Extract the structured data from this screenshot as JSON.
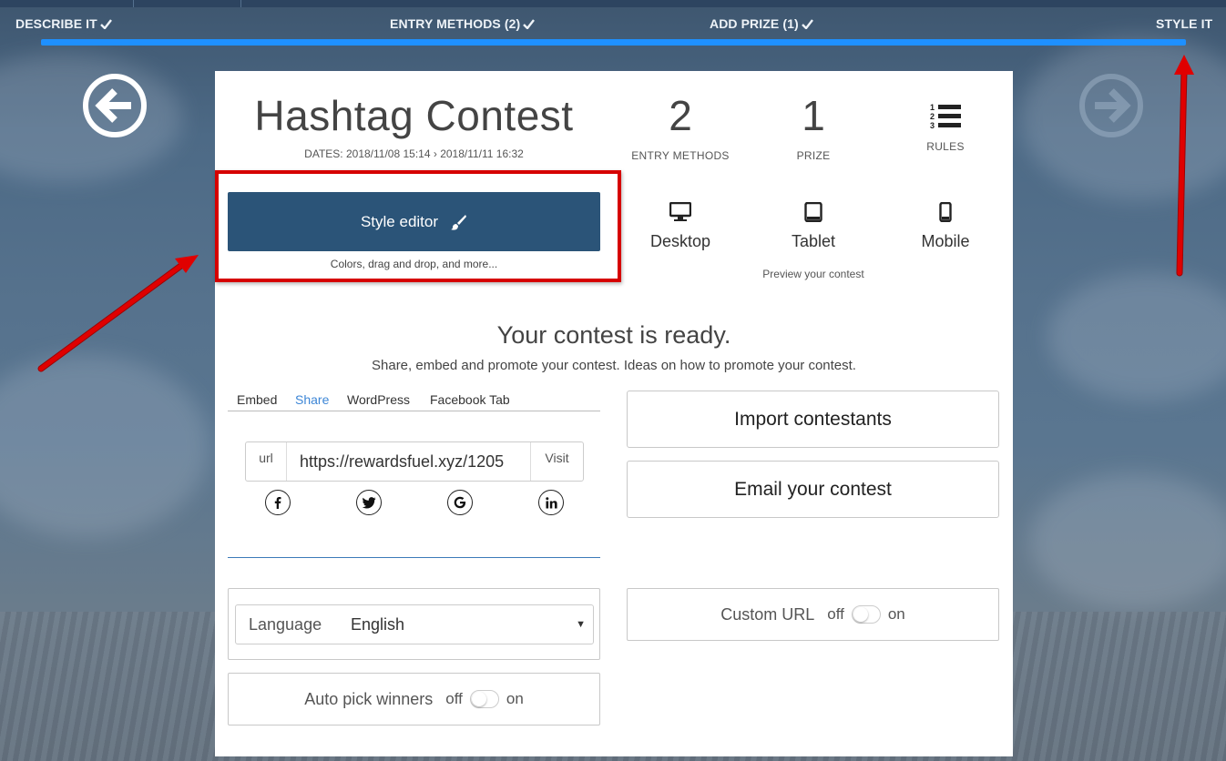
{
  "steps": [
    {
      "label": "DESCRIBE IT",
      "done": true
    },
    {
      "label": "ENTRY METHODS (2)",
      "done": true
    },
    {
      "label": "ADD PRIZE (1)",
      "done": true
    },
    {
      "label": "STYLE IT",
      "done": false
    }
  ],
  "contest": {
    "title": "Hashtag Contest",
    "dates_label": "DATES:",
    "start": "2018/11/08 15:14",
    "end": "2018/11/11 16:32"
  },
  "stats": {
    "entry_methods": {
      "value": "2",
      "label": "ENTRY METHODS"
    },
    "prize": {
      "value": "1",
      "label": "PRIZE"
    },
    "rules": {
      "label": "RULES",
      "icon": "list-ordered-icon"
    }
  },
  "style_editor": {
    "label": "Style editor",
    "sub": "Colors, drag and drop, and more...",
    "icon": "paintbrush-icon",
    "color": "#2b5478"
  },
  "devices": [
    {
      "label": "Desktop",
      "icon": "desktop-icon"
    },
    {
      "label": "Tablet",
      "icon": "tablet-icon"
    },
    {
      "label": "Mobile",
      "icon": "mobile-icon"
    }
  ],
  "preview_label": "Preview your contest",
  "ready": {
    "heading": "Your contest is ready.",
    "sub": "Share, embed and promote your contest. Ideas on how to promote your contest."
  },
  "share_tabs": [
    "Embed",
    "Share",
    "WordPress",
    "Facebook Tab"
  ],
  "active_tab": "Share",
  "url": {
    "label": "url",
    "value": "https://rewardsfuel.xyz/1205",
    "visit": "Visit"
  },
  "social_icons": [
    "facebook-icon",
    "twitter-icon",
    "google-icon",
    "linkedin-icon"
  ],
  "buttons": {
    "import": "Import contestants",
    "email": "Email your contest"
  },
  "language": {
    "label": "Language",
    "value": "English"
  },
  "custom_url": {
    "label": "Custom URL",
    "off": "off",
    "on": "on",
    "state": "off"
  },
  "auto_pick": {
    "label": "Auto pick winners",
    "off": "off",
    "on": "on",
    "state": "off"
  },
  "colors": {
    "accent": "#1e90ff",
    "highlight": "#d60000",
    "link": "#3d86d6"
  }
}
